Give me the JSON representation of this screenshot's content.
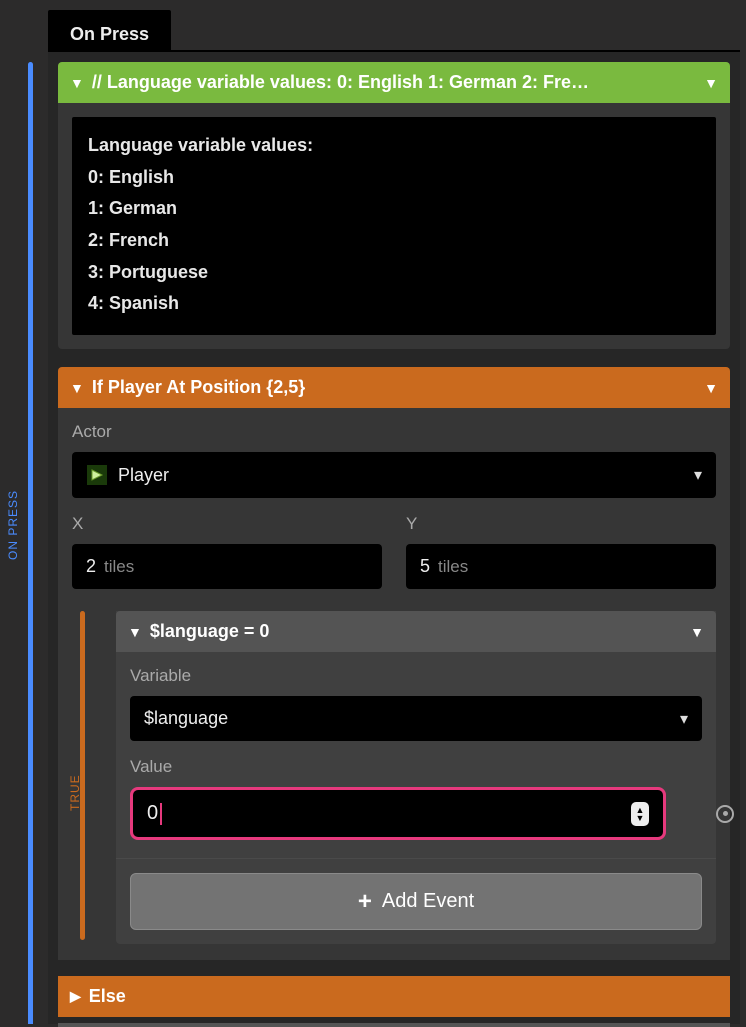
{
  "rails": {
    "on_press_label": "ON PRESS",
    "true_label": "TRUE"
  },
  "tab": {
    "label": "On Press"
  },
  "comment": {
    "header": "// Language variable values: 0: English 1: German 2: Fre…",
    "lines": [
      "Language variable values:",
      "0: English",
      "1: German",
      "2: French",
      "3: Portuguese",
      "4: Spanish"
    ]
  },
  "if_block": {
    "header": "If Player At Position {2,5}",
    "actor": {
      "label": "Actor",
      "value": "Player",
      "icon": "arrow-right-icon"
    },
    "x": {
      "label": "X",
      "value": "2",
      "unit": "tiles"
    },
    "y": {
      "label": "Y",
      "value": "5",
      "unit": "tiles"
    }
  },
  "set_var": {
    "header": "$language = 0",
    "variable": {
      "label": "Variable",
      "value": "$language"
    },
    "value": {
      "label": "Value",
      "value": "0"
    }
  },
  "add_event": {
    "label": "Add Event"
  },
  "else_block": {
    "header": "Else"
  }
}
